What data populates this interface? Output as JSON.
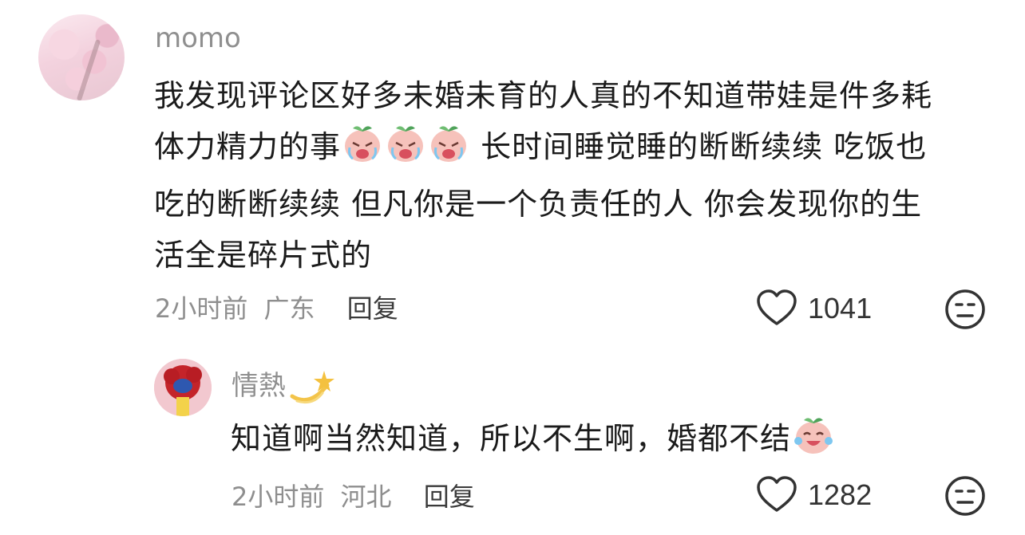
{
  "comments": [
    {
      "username": "momo",
      "text_line1": "我发现评论区好多未婚未育的人真的不知道带娃是件多耗",
      "text_line2a": "体力精力的事",
      "text_line2b": "长时间睡觉睡的断断续续 吃饭也",
      "text_line3": "吃的断断续续 但凡你是一个负责任的人 你会发现你的生",
      "text_line4": "活全是碎片式的",
      "time": "2小时前",
      "location": "广东",
      "reply_label": "回复",
      "likes": "1041",
      "emoji_name": "crying-peach-emoji"
    },
    {
      "username": "情熱",
      "text_a": "知道啊当然知道，所以不生啊，婚都不结",
      "time": "2小时前",
      "location": "河北",
      "reply_label": "回复",
      "likes": "1282",
      "emoji_name": "laughing-crying-peach-emoji"
    }
  ],
  "colors": {
    "text": "#1b1b1b",
    "meta": "#8e8e8e",
    "username": "#8f8f8f"
  }
}
